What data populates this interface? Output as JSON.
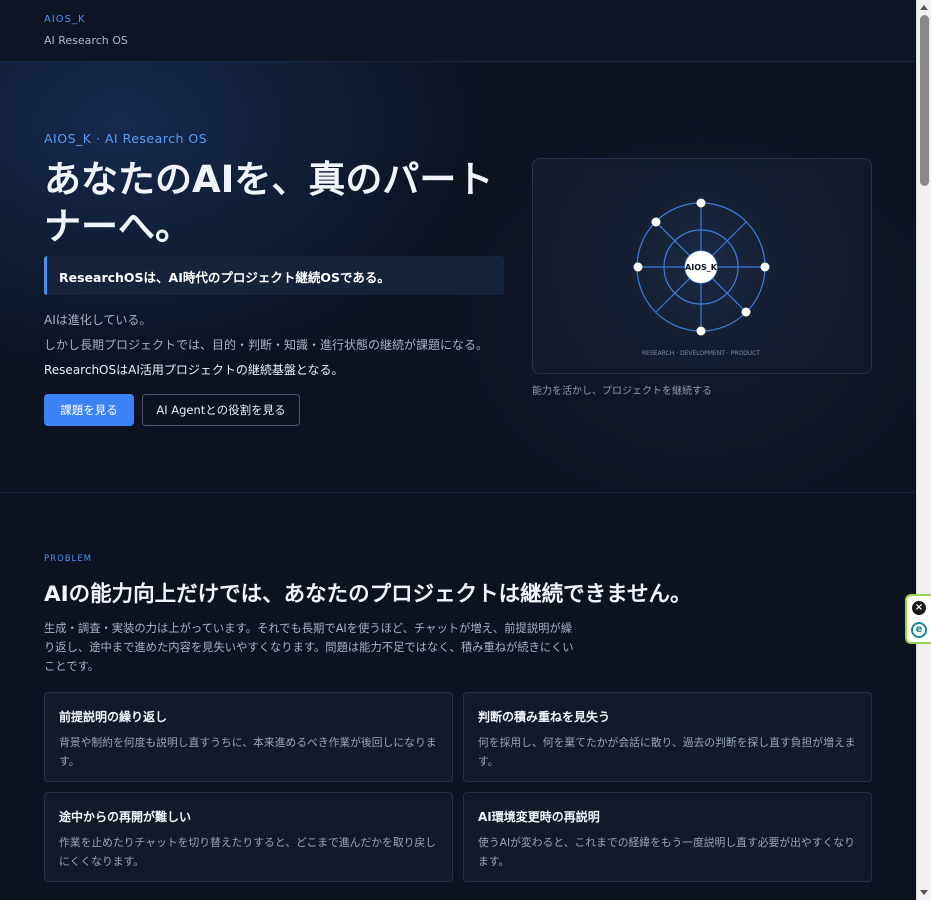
{
  "header": {
    "brand": "AIOS_K",
    "subtitle": "AI Research OS"
  },
  "hero": {
    "eyebrow": "AIOS_K · AI Research OS",
    "title": "あなたのAIを、真のパートナーへ。",
    "callout": "ResearchOSは、AI時代のプロジェクト継続OSである。",
    "lines": [
      "AIは進化している。",
      "しかし長期プロジェクトでは、目的・判断・知識・進行状態の継続が課題になる。",
      "ResearchOSはAI活用プロジェクトの継続基盤となる。"
    ],
    "primary_button": "課題を見る",
    "secondary_button": "AI Agentとの役割を見る",
    "visual": {
      "center_label": "AIOS_K",
      "bottom_label": "RESEARCH · DEVELOPMENT · PRODUCT",
      "caption": "能力を活かし、プロジェクトを継続する"
    }
  },
  "problem": {
    "eyebrow": "PROBLEM",
    "title": "AIの能力向上だけでは、あなたのプロジェクトは継続できません。",
    "description": "生成・調査・実装の力は上がっています。それでも長期でAIを使うほど、チャットが増え、前提説明が繰り返し、途中まで進めた内容を見失いやすくなります。問題は能力不足ではなく、積み重ねが続きにくいことです。",
    "cards": [
      {
        "title": "前提説明の繰り返し",
        "desc": "背景や制約を何度も説明し直すうちに、本来進めるべき作業が後回しになります。"
      },
      {
        "title": "判断の積み重ねを見失う",
        "desc": "何を採用し、何を棄てたかが会話に散り、過去の判断を探し直す負担が増えます。"
      },
      {
        "title": "途中からの再開が難しい",
        "desc": "作業を止めたりチャットを切り替えたりすると、どこまで進んだかを取り戻しにくくなります。"
      },
      {
        "title": "AI環境変更時の再説明",
        "desc": "使うAIが変わると、これまでの経緯をもう一度説明し直す必要が出やすくなります。"
      }
    ]
  },
  "colors": {
    "accent": "#3b82f6",
    "background": "#0c1220",
    "card": "#121a2a"
  },
  "icons": {
    "widget_close": "close-icon",
    "widget_logo": "extension-logo-icon"
  }
}
